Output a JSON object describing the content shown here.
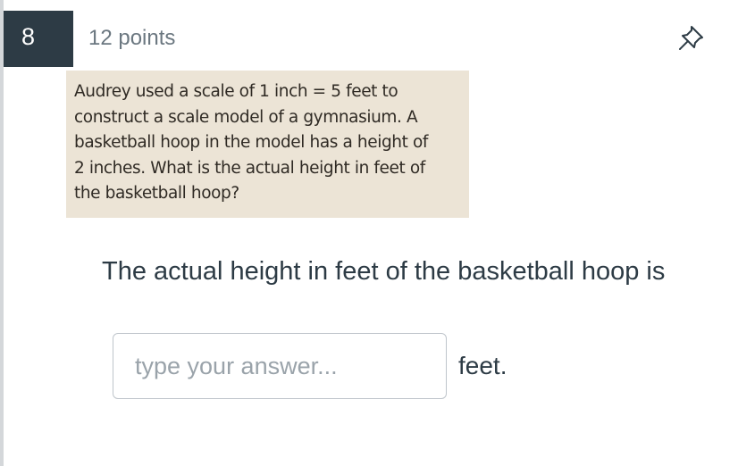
{
  "question": {
    "number": "8",
    "points_label": "12 points",
    "pin_icon": "pin-icon",
    "image_text_lines": [
      "Audrey used a scale of 1 inch = 5 feet to",
      "construct a scale model of a gymnasium. A",
      "basketball hoop in the model has a height of",
      "2 inches. What is the actual height in feet of",
      "the basketball hoop?"
    ],
    "prompt": "The actual height in feet of the basketball hoop is",
    "answer": {
      "value": "",
      "placeholder": "type your answer..."
    },
    "unit": "feet."
  },
  "colors": {
    "header_bg": "#2d3b45",
    "text": "#2d3b45",
    "muted": "#6b7780",
    "scan_bg": "#ece4d6"
  }
}
